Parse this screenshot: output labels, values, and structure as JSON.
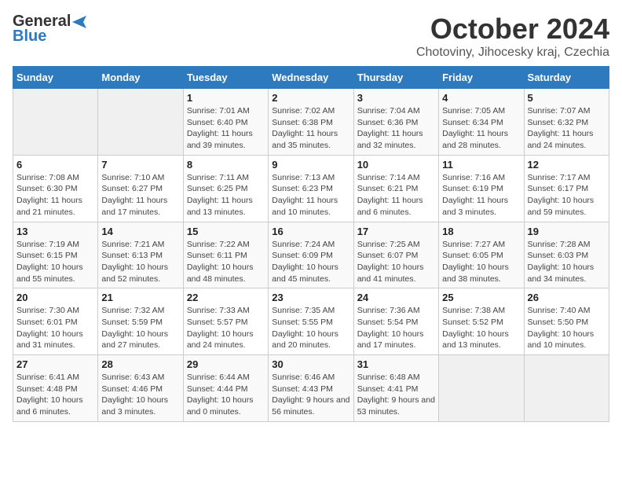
{
  "header": {
    "logo_general": "General",
    "logo_blue": "Blue",
    "title": "October 2024",
    "subtitle": "Chotoviny, Jihocesky kraj, Czechia"
  },
  "weekdays": [
    "Sunday",
    "Monday",
    "Tuesday",
    "Wednesday",
    "Thursday",
    "Friday",
    "Saturday"
  ],
  "weeks": [
    [
      {
        "day": "",
        "empty": true
      },
      {
        "day": "",
        "empty": true
      },
      {
        "day": "1",
        "sunrise": "Sunrise: 7:01 AM",
        "sunset": "Sunset: 6:40 PM",
        "daylight": "Daylight: 11 hours and 39 minutes."
      },
      {
        "day": "2",
        "sunrise": "Sunrise: 7:02 AM",
        "sunset": "Sunset: 6:38 PM",
        "daylight": "Daylight: 11 hours and 35 minutes."
      },
      {
        "day": "3",
        "sunrise": "Sunrise: 7:04 AM",
        "sunset": "Sunset: 6:36 PM",
        "daylight": "Daylight: 11 hours and 32 minutes."
      },
      {
        "day": "4",
        "sunrise": "Sunrise: 7:05 AM",
        "sunset": "Sunset: 6:34 PM",
        "daylight": "Daylight: 11 hours and 28 minutes."
      },
      {
        "day": "5",
        "sunrise": "Sunrise: 7:07 AM",
        "sunset": "Sunset: 6:32 PM",
        "daylight": "Daylight: 11 hours and 24 minutes."
      }
    ],
    [
      {
        "day": "6",
        "sunrise": "Sunrise: 7:08 AM",
        "sunset": "Sunset: 6:30 PM",
        "daylight": "Daylight: 11 hours and 21 minutes."
      },
      {
        "day": "7",
        "sunrise": "Sunrise: 7:10 AM",
        "sunset": "Sunset: 6:27 PM",
        "daylight": "Daylight: 11 hours and 17 minutes."
      },
      {
        "day": "8",
        "sunrise": "Sunrise: 7:11 AM",
        "sunset": "Sunset: 6:25 PM",
        "daylight": "Daylight: 11 hours and 13 minutes."
      },
      {
        "day": "9",
        "sunrise": "Sunrise: 7:13 AM",
        "sunset": "Sunset: 6:23 PM",
        "daylight": "Daylight: 11 hours and 10 minutes."
      },
      {
        "day": "10",
        "sunrise": "Sunrise: 7:14 AM",
        "sunset": "Sunset: 6:21 PM",
        "daylight": "Daylight: 11 hours and 6 minutes."
      },
      {
        "day": "11",
        "sunrise": "Sunrise: 7:16 AM",
        "sunset": "Sunset: 6:19 PM",
        "daylight": "Daylight: 11 hours and 3 minutes."
      },
      {
        "day": "12",
        "sunrise": "Sunrise: 7:17 AM",
        "sunset": "Sunset: 6:17 PM",
        "daylight": "Daylight: 10 hours and 59 minutes."
      }
    ],
    [
      {
        "day": "13",
        "sunrise": "Sunrise: 7:19 AM",
        "sunset": "Sunset: 6:15 PM",
        "daylight": "Daylight: 10 hours and 55 minutes."
      },
      {
        "day": "14",
        "sunrise": "Sunrise: 7:21 AM",
        "sunset": "Sunset: 6:13 PM",
        "daylight": "Daylight: 10 hours and 52 minutes."
      },
      {
        "day": "15",
        "sunrise": "Sunrise: 7:22 AM",
        "sunset": "Sunset: 6:11 PM",
        "daylight": "Daylight: 10 hours and 48 minutes."
      },
      {
        "day": "16",
        "sunrise": "Sunrise: 7:24 AM",
        "sunset": "Sunset: 6:09 PM",
        "daylight": "Daylight: 10 hours and 45 minutes."
      },
      {
        "day": "17",
        "sunrise": "Sunrise: 7:25 AM",
        "sunset": "Sunset: 6:07 PM",
        "daylight": "Daylight: 10 hours and 41 minutes."
      },
      {
        "day": "18",
        "sunrise": "Sunrise: 7:27 AM",
        "sunset": "Sunset: 6:05 PM",
        "daylight": "Daylight: 10 hours and 38 minutes."
      },
      {
        "day": "19",
        "sunrise": "Sunrise: 7:28 AM",
        "sunset": "Sunset: 6:03 PM",
        "daylight": "Daylight: 10 hours and 34 minutes."
      }
    ],
    [
      {
        "day": "20",
        "sunrise": "Sunrise: 7:30 AM",
        "sunset": "Sunset: 6:01 PM",
        "daylight": "Daylight: 10 hours and 31 minutes."
      },
      {
        "day": "21",
        "sunrise": "Sunrise: 7:32 AM",
        "sunset": "Sunset: 5:59 PM",
        "daylight": "Daylight: 10 hours and 27 minutes."
      },
      {
        "day": "22",
        "sunrise": "Sunrise: 7:33 AM",
        "sunset": "Sunset: 5:57 PM",
        "daylight": "Daylight: 10 hours and 24 minutes."
      },
      {
        "day": "23",
        "sunrise": "Sunrise: 7:35 AM",
        "sunset": "Sunset: 5:55 PM",
        "daylight": "Daylight: 10 hours and 20 minutes."
      },
      {
        "day": "24",
        "sunrise": "Sunrise: 7:36 AM",
        "sunset": "Sunset: 5:54 PM",
        "daylight": "Daylight: 10 hours and 17 minutes."
      },
      {
        "day": "25",
        "sunrise": "Sunrise: 7:38 AM",
        "sunset": "Sunset: 5:52 PM",
        "daylight": "Daylight: 10 hours and 13 minutes."
      },
      {
        "day": "26",
        "sunrise": "Sunrise: 7:40 AM",
        "sunset": "Sunset: 5:50 PM",
        "daylight": "Daylight: 10 hours and 10 minutes."
      }
    ],
    [
      {
        "day": "27",
        "sunrise": "Sunrise: 6:41 AM",
        "sunset": "Sunset: 4:48 PM",
        "daylight": "Daylight: 10 hours and 6 minutes."
      },
      {
        "day": "28",
        "sunrise": "Sunrise: 6:43 AM",
        "sunset": "Sunset: 4:46 PM",
        "daylight": "Daylight: 10 hours and 3 minutes."
      },
      {
        "day": "29",
        "sunrise": "Sunrise: 6:44 AM",
        "sunset": "Sunset: 4:44 PM",
        "daylight": "Daylight: 10 hours and 0 minutes."
      },
      {
        "day": "30",
        "sunrise": "Sunrise: 6:46 AM",
        "sunset": "Sunset: 4:43 PM",
        "daylight": "Daylight: 9 hours and 56 minutes."
      },
      {
        "day": "31",
        "sunrise": "Sunrise: 6:48 AM",
        "sunset": "Sunset: 4:41 PM",
        "daylight": "Daylight: 9 hours and 53 minutes."
      },
      {
        "day": "",
        "empty": true
      },
      {
        "day": "",
        "empty": true
      }
    ]
  ]
}
